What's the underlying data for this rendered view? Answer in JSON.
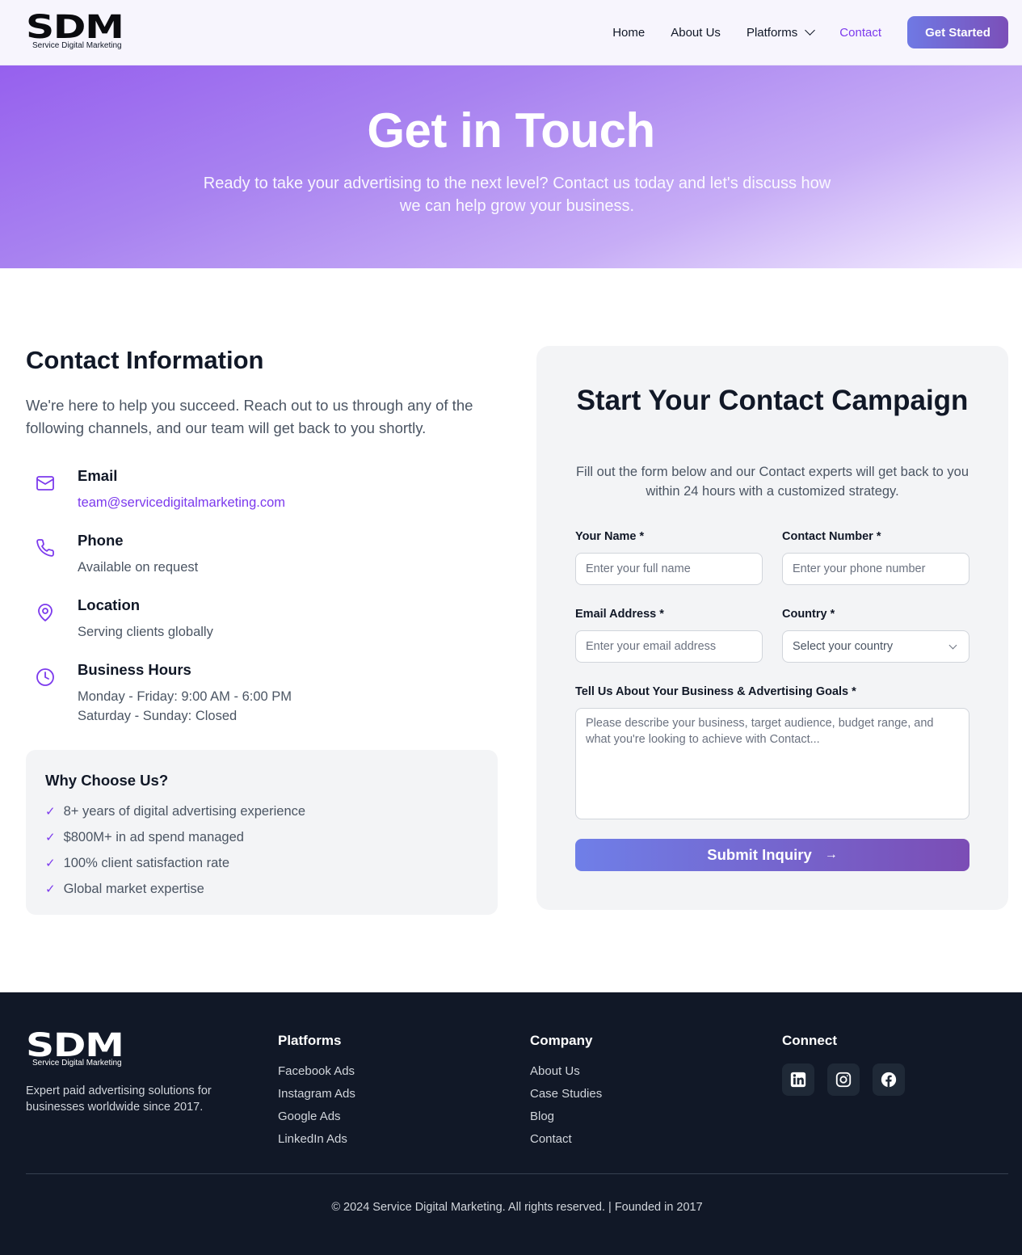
{
  "brand": {
    "logo_text": "SDM",
    "logo_sub": "Service Digital Marketing"
  },
  "nav": {
    "items": [
      {
        "label": "Home"
      },
      {
        "label": "About Us"
      },
      {
        "label": "Platforms"
      },
      {
        "label": "Contact"
      }
    ],
    "cta": "Get Started"
  },
  "hero": {
    "title": "Get in Touch",
    "subtitle": "Ready to take your advertising to the next level? Contact us today and let's discuss how we can help grow your business."
  },
  "contact_info": {
    "title": "Contact Information",
    "intro": "We're here to help you succeed. Reach out to us through any of the following channels, and our team will get back to you shortly.",
    "items": [
      {
        "icon": "mail-icon",
        "label": "Email",
        "value": "team@servicedigitalmarketing.com"
      },
      {
        "icon": "phone-icon",
        "label": "Phone",
        "value": "Available on request"
      },
      {
        "icon": "map-pin-icon",
        "label": "Location",
        "value": "Serving clients globally"
      },
      {
        "icon": "clock-icon",
        "label": "Business Hours",
        "value": "Monday - Friday: 9:00 AM - 6:00 PM",
        "value2": "Saturday - Sunday: Closed"
      }
    ]
  },
  "why": {
    "title": "Why Choose Us?",
    "check": "✓",
    "items": [
      "8+ years of digital advertising experience",
      "$800M+ in ad spend managed",
      "100% client satisfaction rate",
      "Global market expertise"
    ]
  },
  "form": {
    "title": "Start Your Contact Campaign",
    "subtitle": "Fill out the form below and our Contact experts will get back to you within 24 hours with a customized strategy.",
    "name_label": "Your Name *",
    "name_placeholder": "Enter your full name",
    "phone_label": "Contact Number *",
    "phone_placeholder": "Enter your phone number",
    "email_label": "Email Address *",
    "email_placeholder": "Enter your email address",
    "country_label": "Country *",
    "country_value": "Select your country",
    "goals_label": "Tell Us About Your Business & Advertising Goals *",
    "goals_placeholder": "Please describe your business, target audience, budget range, and what you're looking to achieve with Contact...",
    "submit": "Submit Inquiry",
    "submit_icon": "→"
  },
  "footer": {
    "description": "Expert paid advertising solutions for businesses worldwide since 2017.",
    "platforms": {
      "title": "Platforms",
      "links": [
        "Facebook Ads",
        "Instagram Ads",
        "Google Ads",
        "LinkedIn Ads"
      ]
    },
    "company": {
      "title": "Company",
      "links": [
        "About Us",
        "Case Studies",
        "Blog",
        "Contact"
      ]
    },
    "connect": {
      "title": "Connect",
      "icons": [
        "linkedin-icon",
        "instagram-icon",
        "facebook-icon"
      ]
    },
    "copyright": "© 2024 Service Digital Marketing. All rights reserved. | Founded in 2017"
  },
  "colors": {
    "accent": "#7c3aed",
    "footer_bg": "#111827",
    "card_bg": "#f3f4f6"
  }
}
